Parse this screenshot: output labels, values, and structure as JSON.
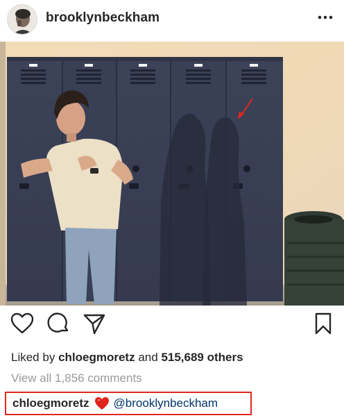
{
  "post": {
    "username": "brooklynbeckham",
    "more_icon": "more-horizontal-icon"
  },
  "actions": {
    "like_icon": "heart-outline-icon",
    "comment_icon": "comment-bubble-icon",
    "share_icon": "paper-plane-icon",
    "save_icon": "bookmark-icon"
  },
  "likes": {
    "prefix": "Liked by",
    "user": "chloegmoretz",
    "connector": "and",
    "count": "515,689 others"
  },
  "comments": {
    "view_all": "View all 1,856 comments"
  },
  "caption": {
    "username": "chloegmoretz",
    "emoji": "red-heart-emoji",
    "mention": "@brooklynbeckham"
  },
  "colors": {
    "highlight_border": "#e0281e",
    "mention": "#003569",
    "muted": "#999999",
    "text": "#262626"
  }
}
